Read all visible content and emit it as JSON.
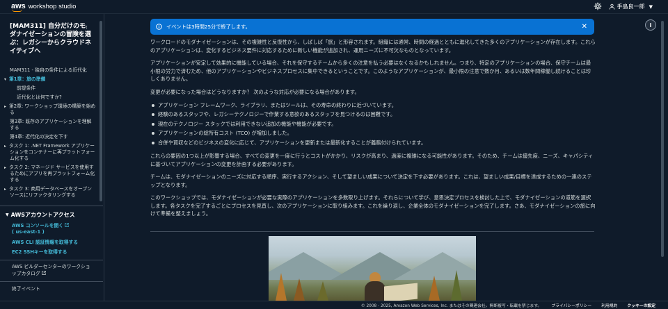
{
  "header": {
    "logo_aws": "aws",
    "logo_text": "workshop studio",
    "settings_icon": "gear-icon",
    "user_icon": "user-icon",
    "user_name": "手島良一郎"
  },
  "sidebar": {
    "title": "[MAM311] 自分だけのモダナイゼーションの冒険を選ぶ：レガシーからクラウドネイティブへ",
    "items": [
      {
        "label": "MAM311 - 独自の条件による近代化",
        "type": "plain"
      },
      {
        "label": "第1章：旅の準備",
        "type": "active"
      },
      {
        "label": "前提条件",
        "type": "sub"
      },
      {
        "label": "近代化とは何ですか?",
        "type": "sub"
      },
      {
        "label": "第2章: ワークショップ環境の構築を始める",
        "type": "chev"
      },
      {
        "label": "第3章: 既存のアプリケーションを理解する",
        "type": "plain"
      },
      {
        "label": "第4章: 近代化の決定を下す",
        "type": "plain"
      },
      {
        "label": "タスク 1: .NET Framework アプリケーションをコンテナーに再プラットフォーム化する",
        "type": "chev"
      },
      {
        "label": "タスク 2: マネージド サービスを使用するためにアプリを再プラットフォーム化する",
        "type": "chev"
      },
      {
        "label": "タスク 3: 商用データベースをオープンソースにリファクタリングする",
        "type": "chev"
      }
    ],
    "access_heading": "AWSアカウントアクセス",
    "console_link": "AWS コンソールを開く",
    "console_region": "( us-east-1 )",
    "cli_link": "AWS CLI 認証情報を取得する",
    "ssh_link": "EC2 SSHキーを取得する",
    "builder_text": "AWS ビルダーセンターのワークショップカタログ",
    "end_event": "終了イベント"
  },
  "flash": {
    "info_icon": "info-icon",
    "text": "イベントは3時間25分で終了します。",
    "close_icon": "close-icon"
  },
  "help_label": "i",
  "content": {
    "p1": "ワークロードのモダナイゼーションは、その複雑性と反復性から、しばしば「旅」と形容されます。組織には通常、時間の経過とともに進化してきた多くのアプリケーションが存在します。これらのアプリケーションは、変化するビジネス要件に対応するために新しい機能が追加され、運用ニーズに不可欠なものとなっています。",
    "p2": "アプリケーションが安定して効果的に機能している場合、それを保守するチームから多くの注意を払う必要はなくなるかもしれません。つまり、特定のアプリケーションの場合、保守チームは最小限の労力で済むため、他のアプリケーションやビジネスプロセスに集中できるということです。このようなアプリケーションが、最小限の注意で数か月、あるいは数年間稼働し続けることは珍しくありません。",
    "p3": "変更が必要になった場合はどうなりますか？ 次のような対応が必要になる場合があります。",
    "bullets": [
      "アプリケーション フレームワーク、ライブラリ、またはツールは、その寿命の終わりに近づいています。",
      "経験のあるスタッフや、レガシーテクノロジーで作業する意欲のあるスタッフを見つけるのは困難です。",
      "現在のテクノロジー スタックでは利用できない追加の機能や機能が必要です。",
      "アプリケーションの総所有コスト (TCO) が増加しました。",
      "合併や買収などのビジネスの変化に応じて、アプリケーションを更新または最新化することが義務付けられています。"
    ],
    "p4": "これらの要因の1つ以上が影響する場合、すべての変更を一度に行うとコストがかかり、リスクが高まり、過度に複雑になる可能性があります。そのため、チームは優先度、ニーズ、キャパシティに基づいてアプリケーションの変更を計画する必要があります。",
    "p5": "チームは、モダナイゼーションのニーズに対応する順序、実行するアクション、そして望ましい成果について決定を下す必要があります。これは、望ましい成果/目標を達成するための一連のステップとなります。",
    "p6": "このワークショップでは、モダナイゼーションが必要な実際のアプリケーションを多数取り上げます。それらについて学び、意思決定プロセスを検討した上で、モダナイゼーションの道筋を選択します。各タスクを完了するごとにプロセスを見直し、次のアプリケーションに取り組みます。これを繰り返し、企業全体のモダナイゼーションを完了します。さあ、モダナイゼーションの旅に向けて準備を整えましょう。"
  },
  "footer": {
    "copyright": "© 2008 - 2025, Amazon Web Services, Inc. またはその関連会社。無断複写・転載を禁じます。",
    "privacy": "プライバシーポリシー",
    "terms": "利用規約",
    "cookies": "クッキーの設定"
  }
}
